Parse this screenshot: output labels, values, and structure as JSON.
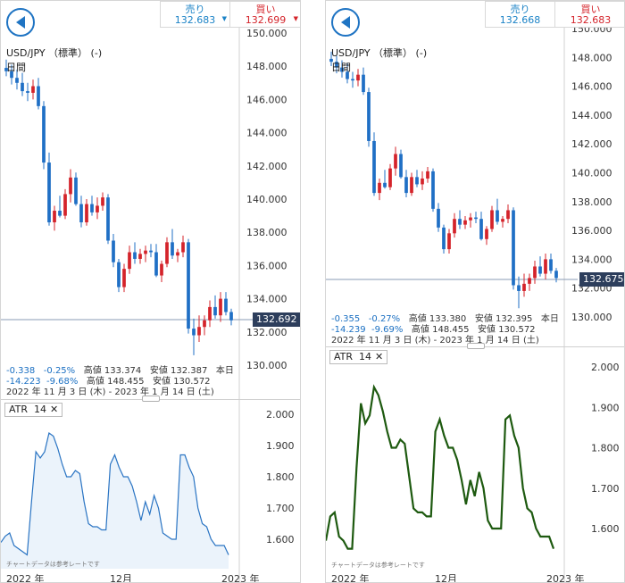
{
  "colors": {
    "up": "#d4232a",
    "down": "#1f6fc5",
    "sell": "#1a82c6",
    "buy": "#d4232a",
    "price_tag_bg": "#2d3e5c",
    "atr_left": "#2a74c3",
    "atr_right": "#1e5a10"
  },
  "panels": [
    {
      "id": "left",
      "back_icon": "back-arrow-icon",
      "sell": {
        "label": "売り",
        "price": "132.683"
      },
      "buy": {
        "label": "買い",
        "price": "132.699"
      },
      "pair": "USD/JPY （標準） (-)",
      "timeframe": "日間",
      "current_price": "132.692",
      "stats": {
        "change": "-0.338",
        "change_pct": "-0.25%",
        "high_label": "高値",
        "high": "133.374",
        "low_label": "安値",
        "low": "132.387",
        "today": "本日",
        "period_change": "-14.223",
        "period_pct": "-9.68%",
        "period_high_label": "高値",
        "period_high": "148.455",
        "period_low_label": "安値",
        "period_low": "130.572",
        "range": "2022 年 11 月 3 日 (木) - 2023 年 1 月 14 日 (土)"
      },
      "indicator": {
        "name": "ATR",
        "period": "14",
        "close_icon": "close-icon"
      },
      "note": "チャートデータは参考レートです",
      "x_labels": [
        "2022 年",
        "12月",
        "2023 年"
      ]
    },
    {
      "id": "right",
      "back_icon": "back-arrow-icon",
      "sell": {
        "label": "売り",
        "price": "132.668"
      },
      "buy": {
        "label": "買い",
        "price": "132.683"
      },
      "pair": "USD/JPY （標準） (-)",
      "timeframe": "日間",
      "current_price": "132.675",
      "stats": {
        "change": "-0.355",
        "change_pct": "-0.27%",
        "high_label": "高値",
        "high": "133.380",
        "low_label": "安値",
        "low": "132.395",
        "today": "本日",
        "period_change": "-14.239",
        "period_pct": "-9.69%",
        "period_high_label": "高値",
        "period_high": "148.455",
        "period_low_label": "安値",
        "period_low": "130.572",
        "range": "2022 年 11 月 3 日 (木) - 2023 年 1 月 14 日 (土)"
      },
      "indicator": {
        "name": "ATR",
        "period": "14",
        "close_icon": "close-icon"
      },
      "note": "チャートデータは参考レートです",
      "x_labels": [
        "2022 年",
        "12月",
        "2023 年"
      ]
    }
  ],
  "chart_data": [
    {
      "type": "candlestick",
      "panel": "left",
      "price_axis": {
        "ticks": [
          "150.000",
          "148.000",
          "146.000",
          "144.000",
          "142.000",
          "140.000",
          "138.000",
          "136.000",
          "134.000",
          "132.000",
          "130.000"
        ],
        "range": [
          129.5,
          150.0
        ]
      },
      "candles": [
        [
          147.9,
          148.4,
          147.4,
          147.7
        ],
        [
          147.7,
          148.1,
          146.9,
          147.3
        ],
        [
          147.3,
          147.8,
          146.6,
          147.0
        ],
        [
          147.0,
          147.6,
          146.2,
          146.5
        ],
        [
          146.5,
          147.0,
          145.9,
          146.4
        ],
        [
          146.4,
          147.2,
          146.0,
          146.8
        ],
        [
          146.8,
          147.3,
          145.4,
          145.6
        ],
        [
          145.6,
          145.9,
          141.8,
          142.2
        ],
        [
          142.2,
          142.8,
          138.4,
          138.6
        ],
        [
          138.6,
          139.6,
          138.1,
          139.3
        ],
        [
          139.3,
          140.2,
          138.9,
          139.0
        ],
        [
          139.0,
          140.6,
          138.8,
          140.3
        ],
        [
          140.3,
          141.8,
          139.8,
          141.3
        ],
        [
          141.3,
          141.6,
          139.6,
          139.7
        ],
        [
          139.7,
          140.2,
          138.3,
          138.6
        ],
        [
          138.6,
          140.0,
          138.4,
          139.7
        ],
        [
          139.7,
          140.2,
          139.0,
          139.2
        ],
        [
          139.2,
          140.1,
          138.8,
          139.6
        ],
        [
          139.6,
          140.4,
          139.3,
          140.1
        ],
        [
          140.1,
          140.3,
          137.3,
          137.5
        ],
        [
          137.5,
          137.9,
          135.9,
          136.2
        ],
        [
          136.2,
          136.4,
          134.4,
          134.7
        ],
        [
          134.7,
          136.1,
          134.4,
          135.8
        ],
        [
          135.8,
          137.2,
          135.5,
          136.8
        ],
        [
          136.8,
          137.4,
          136.1,
          136.4
        ],
        [
          136.4,
          137.0,
          136.1,
          136.7
        ],
        [
          136.7,
          137.2,
          136.2,
          136.9
        ],
        [
          136.9,
          137.3,
          136.5,
          136.8
        ],
        [
          136.8,
          137.3,
          135.3,
          135.4
        ],
        [
          135.4,
          136.3,
          135.0,
          136.1
        ],
        [
          136.1,
          137.7,
          135.9,
          137.4
        ],
        [
          137.4,
          138.2,
          136.4,
          136.6
        ],
        [
          136.6,
          137.0,
          136.2,
          136.8
        ],
        [
          136.8,
          137.8,
          136.5,
          137.4
        ],
        [
          137.4,
          137.6,
          131.9,
          132.2
        ],
        [
          132.2,
          132.8,
          130.6,
          131.8
        ],
        [
          131.8,
          133.0,
          131.4,
          132.3
        ],
        [
          132.3,
          133.0,
          131.8,
          132.7
        ],
        [
          132.7,
          133.9,
          132.3,
          133.5
        ],
        [
          133.5,
          134.2,
          132.8,
          133.0
        ],
        [
          133.0,
          134.4,
          132.6,
          134.0
        ],
        [
          134.0,
          134.4,
          133.0,
          133.2
        ],
        [
          133.2,
          133.4,
          132.4,
          132.7
        ]
      ],
      "atr": {
        "label": "ATR",
        "period": 14,
        "ticks": [
          "2.000",
          "1.900",
          "1.800",
          "1.700",
          "1.600"
        ],
        "range": [
          1.52,
          2.03
        ],
        "values": [
          1.59,
          1.61,
          1.62,
          1.58,
          1.57,
          1.56,
          1.55,
          1.72,
          1.88,
          1.86,
          1.88,
          1.94,
          1.93,
          1.89,
          1.84,
          1.8,
          1.8,
          1.82,
          1.81,
          1.72,
          1.65,
          1.64,
          1.64,
          1.63,
          1.63,
          1.84,
          1.87,
          1.83,
          1.8,
          1.8,
          1.77,
          1.72,
          1.66,
          1.72,
          1.68,
          1.74,
          1.7,
          1.62,
          1.61,
          1.6,
          1.6,
          1.87,
          1.87,
          1.83,
          1.8,
          1.7,
          1.65,
          1.64,
          1.6,
          1.58,
          1.58,
          1.58,
          1.55
        ]
      }
    },
    {
      "type": "candlestick",
      "panel": "right",
      "price_axis": {
        "ticks": [
          "150.000",
          "148.000",
          "146.000",
          "144.000",
          "142.000",
          "140.000",
          "138.000",
          "136.000",
          "134.000",
          "132.000",
          "130.000"
        ],
        "range": [
          129.5,
          150.0
        ]
      },
      "candles": [
        [
          147.9,
          148.4,
          147.4,
          147.7
        ],
        [
          147.7,
          148.1,
          146.9,
          147.3
        ],
        [
          147.3,
          147.8,
          146.6,
          147.0
        ],
        [
          147.0,
          147.6,
          146.2,
          146.5
        ],
        [
          146.5,
          147.0,
          145.9,
          146.4
        ],
        [
          146.4,
          147.2,
          146.0,
          146.8
        ],
        [
          146.8,
          147.3,
          145.4,
          145.6
        ],
        [
          145.6,
          145.9,
          141.8,
          142.2
        ],
        [
          142.2,
          142.8,
          138.4,
          138.6
        ],
        [
          138.6,
          139.6,
          138.1,
          139.3
        ],
        [
          139.3,
          140.2,
          138.9,
          139.0
        ],
        [
          139.0,
          140.6,
          138.8,
          140.3
        ],
        [
          140.3,
          141.8,
          139.8,
          141.3
        ],
        [
          141.3,
          141.6,
          139.6,
          139.7
        ],
        [
          139.7,
          140.2,
          138.3,
          138.6
        ],
        [
          138.6,
          140.0,
          138.4,
          139.7
        ],
        [
          139.7,
          140.2,
          139.0,
          139.2
        ],
        [
          139.2,
          140.1,
          138.8,
          139.6
        ],
        [
          139.6,
          140.4,
          139.3,
          140.1
        ],
        [
          140.1,
          140.3,
          137.3,
          137.5
        ],
        [
          137.5,
          137.9,
          135.9,
          136.2
        ],
        [
          136.2,
          136.4,
          134.4,
          134.7
        ],
        [
          134.7,
          136.1,
          134.4,
          135.8
        ],
        [
          135.8,
          137.2,
          135.5,
          136.8
        ],
        [
          136.8,
          137.4,
          136.1,
          136.4
        ],
        [
          136.4,
          137.0,
          136.1,
          136.7
        ],
        [
          136.7,
          137.2,
          136.2,
          136.9
        ],
        [
          136.9,
          137.3,
          136.5,
          136.8
        ],
        [
          136.8,
          137.3,
          135.3,
          135.4
        ],
        [
          135.4,
          136.3,
          135.0,
          136.1
        ],
        [
          136.1,
          137.7,
          135.9,
          137.4
        ],
        [
          137.4,
          138.2,
          136.4,
          136.6
        ],
        [
          136.6,
          137.0,
          136.2,
          136.8
        ],
        [
          136.8,
          137.8,
          136.5,
          137.4
        ],
        [
          137.4,
          137.6,
          131.9,
          132.2
        ],
        [
          132.2,
          132.8,
          130.6,
          131.8
        ],
        [
          131.8,
          133.0,
          131.4,
          132.3
        ],
        [
          132.3,
          133.0,
          131.8,
          132.7
        ],
        [
          132.7,
          133.9,
          132.3,
          133.5
        ],
        [
          133.5,
          134.2,
          132.8,
          133.0
        ],
        [
          133.0,
          134.4,
          132.6,
          134.0
        ],
        [
          134.0,
          134.4,
          133.0,
          133.2
        ],
        [
          133.2,
          133.4,
          132.4,
          132.7
        ]
      ],
      "atr": {
        "label": "ATR",
        "period": 14,
        "ticks": [
          "2.000",
          "1.900",
          "1.800",
          "1.700",
          "1.600"
        ],
        "range": [
          1.52,
          2.03
        ],
        "values": [
          1.57,
          1.63,
          1.64,
          1.58,
          1.57,
          1.55,
          1.55,
          1.75,
          1.91,
          1.86,
          1.88,
          1.95,
          1.93,
          1.89,
          1.84,
          1.8,
          1.8,
          1.82,
          1.81,
          1.73,
          1.65,
          1.64,
          1.64,
          1.63,
          1.63,
          1.84,
          1.87,
          1.83,
          1.8,
          1.8,
          1.77,
          1.72,
          1.66,
          1.72,
          1.68,
          1.74,
          1.7,
          1.62,
          1.6,
          1.6,
          1.6,
          1.87,
          1.88,
          1.83,
          1.8,
          1.7,
          1.65,
          1.64,
          1.6,
          1.58,
          1.58,
          1.58,
          1.55
        ]
      }
    }
  ]
}
